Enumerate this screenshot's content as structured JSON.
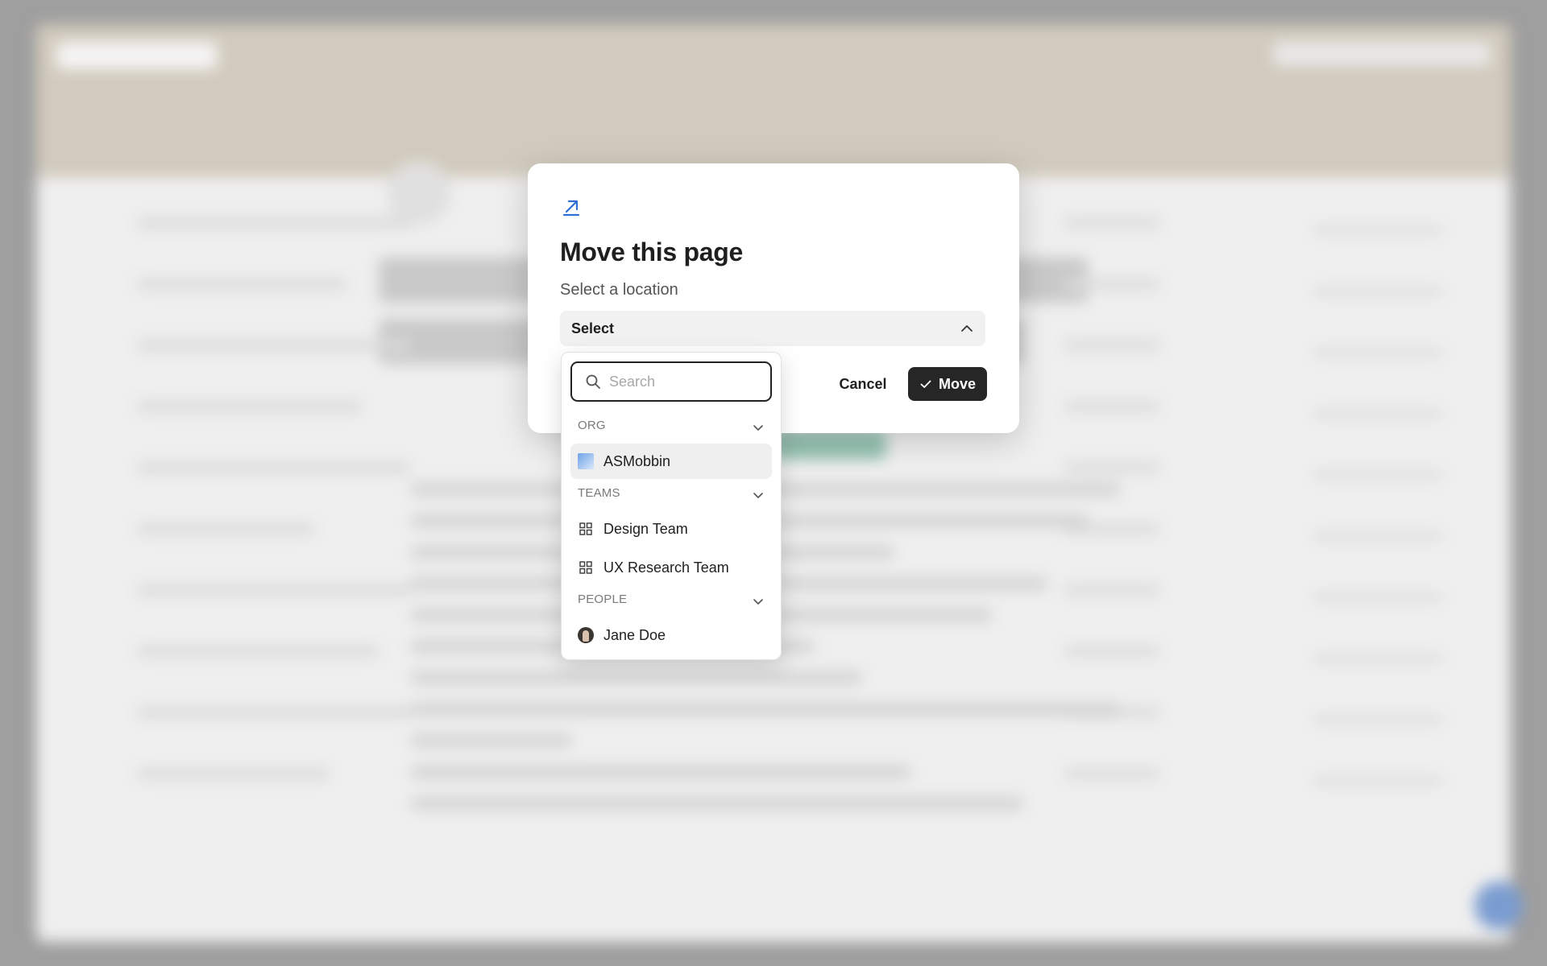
{
  "modal": {
    "title": "Move this page",
    "subtitle": "Select a location",
    "select_label": "Select",
    "cancel_label": "Cancel",
    "move_label": "Move"
  },
  "dropdown": {
    "search_placeholder": "Search",
    "groups": [
      {
        "label": "ORG",
        "items": [
          {
            "label": "ASMobbin",
            "icon": "org-logo-icon"
          }
        ]
      },
      {
        "label": "TEAMS",
        "items": [
          {
            "label": "Design Team",
            "icon": "grid-icon"
          },
          {
            "label": "UX Research Team",
            "icon": "grid-icon"
          }
        ]
      },
      {
        "label": "PEOPLE",
        "items": [
          {
            "label": "Jane Doe",
            "icon": "avatar"
          }
        ]
      }
    ]
  },
  "colors": {
    "accent_icon": "#2f6fd6",
    "primary_button": "#262626",
    "highlight_row": "#efefef"
  }
}
